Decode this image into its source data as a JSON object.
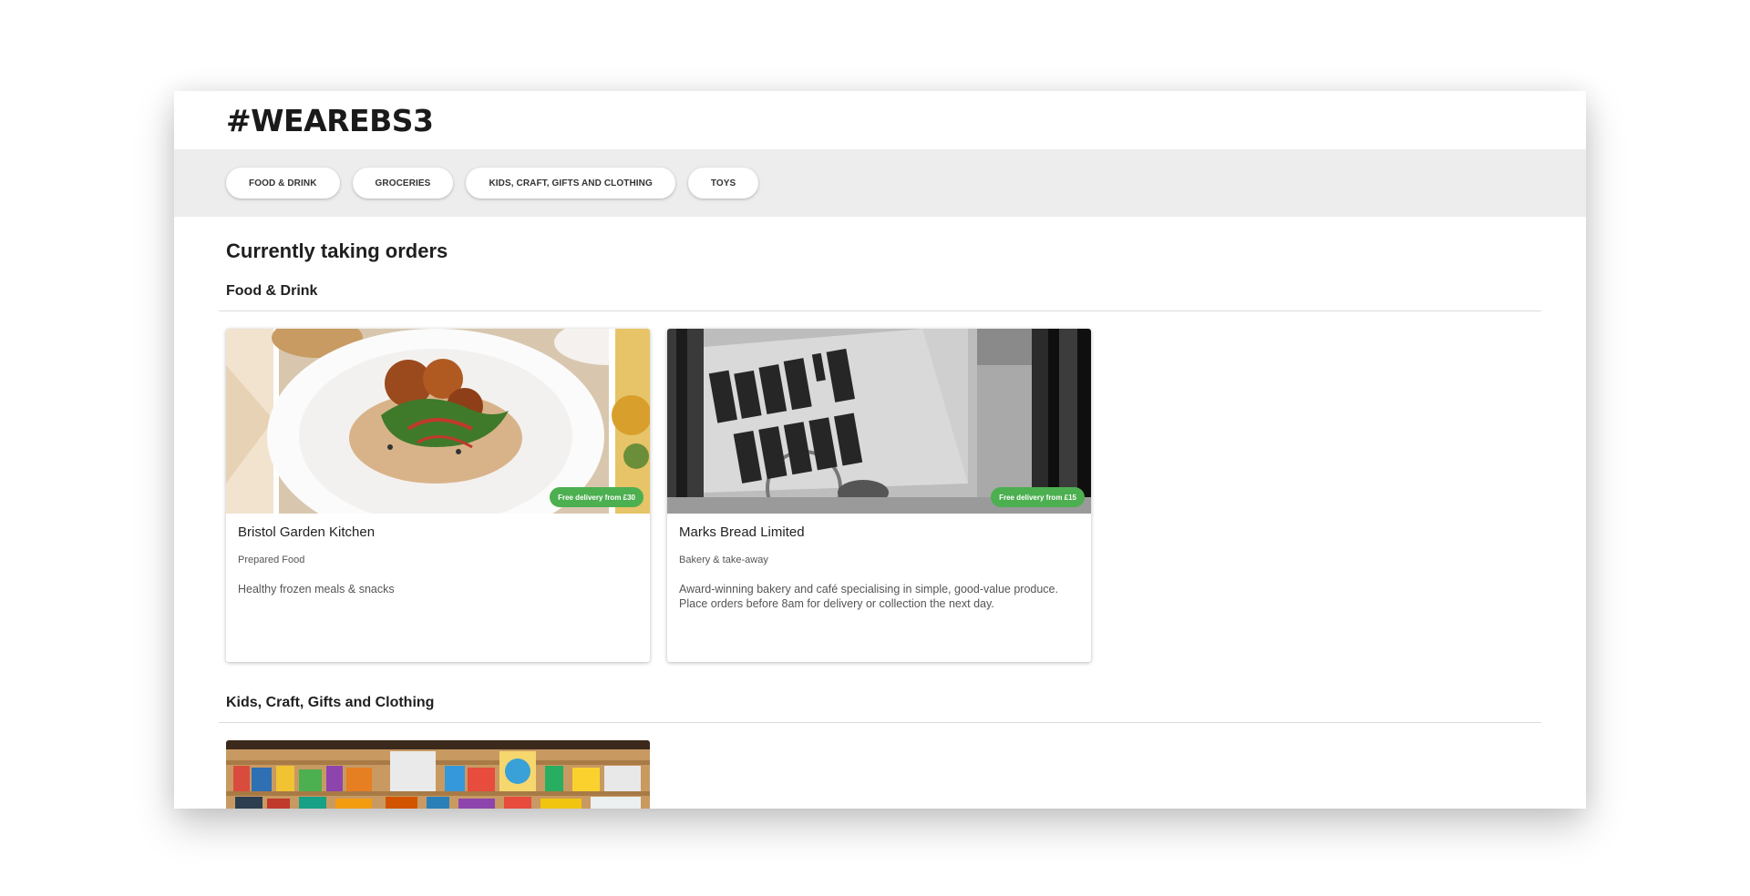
{
  "site": {
    "logo": "#WEAREBS3"
  },
  "nav": {
    "categories": [
      "FOOD & DRINK",
      "GROCERIES",
      "KIDS, CRAFT, GIFTS AND CLOTHING",
      "TOYS"
    ]
  },
  "page": {
    "title": "Currently taking orders"
  },
  "sections": [
    {
      "heading": "Food & Drink",
      "cards": [
        {
          "name": "Bristol Garden Kitchen",
          "type": "Prepared Food",
          "description": "Healthy frozen meals & snacks",
          "badge": "Free delivery from £30"
        },
        {
          "name": "Marks Bread Limited",
          "type": "Bakery & take-away",
          "description": "Award-winning bakery and café specialising in simple, good-value produce. Place orders before 8am for delivery or collection the next day.",
          "badge": "Free delivery from £15"
        }
      ]
    },
    {
      "heading": "Kids, Craft, Gifts and Clothing",
      "cards": []
    }
  ],
  "colors": {
    "badge": "#4caf50",
    "nav_bg": "#ededed"
  }
}
